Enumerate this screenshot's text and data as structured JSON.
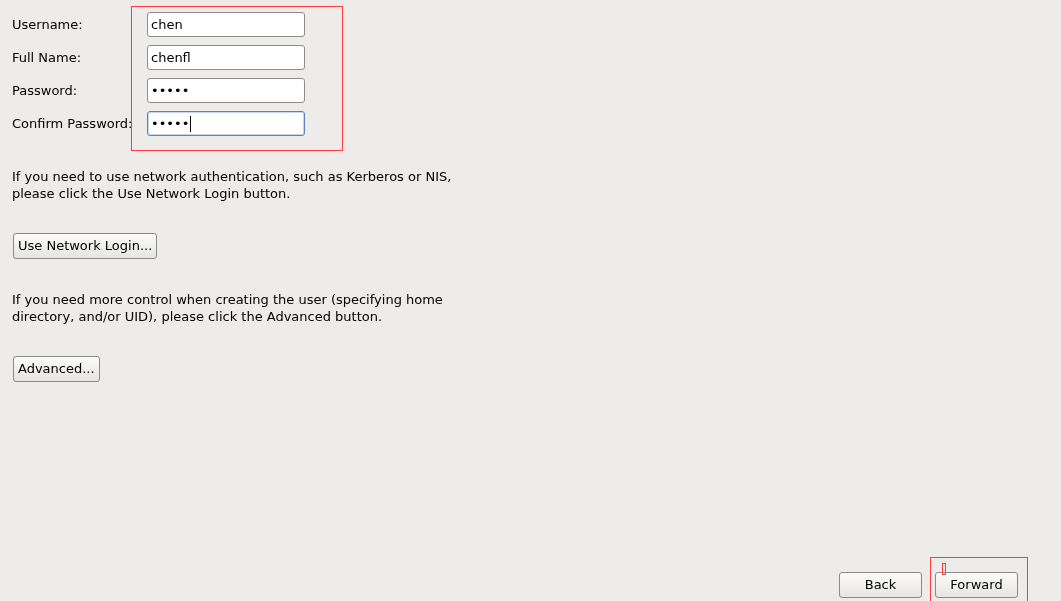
{
  "form": {
    "fields": [
      {
        "label": "Username:",
        "value": "chen",
        "focused": false
      },
      {
        "label": "Full Name:",
        "value": "chenfl",
        "focused": false
      },
      {
        "label": "Password:",
        "value": "•••••",
        "focused": false
      },
      {
        "label": "Confirm Password:",
        "value": "•••••",
        "focused": true
      }
    ]
  },
  "notes": [
    {
      "text": "If you need to use network authentication, such as Kerberos or NIS, please click the Use Network Login button.",
      "button": "Use Network Login..."
    },
    {
      "text": "If you need more control when creating the user (specifying home directory, and/or UID), please click the Advanced button.",
      "button": "Advanced..."
    }
  ],
  "navigation": {
    "buttons": [
      "Back",
      "Forward"
    ]
  }
}
